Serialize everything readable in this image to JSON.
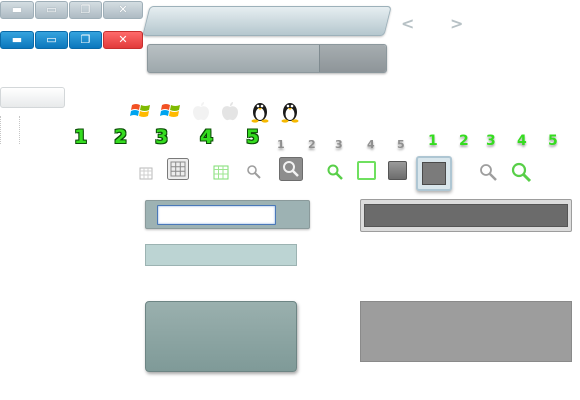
{
  "window_controls": {
    "row1": [
      {
        "name": "minimize",
        "glyph": "▬"
      },
      {
        "name": "maximize",
        "glyph": "▭"
      },
      {
        "name": "restore",
        "glyph": "❐"
      },
      {
        "name": "close",
        "glyph": "✕"
      }
    ],
    "row2": [
      {
        "name": "minimize",
        "glyph": "▬"
      },
      {
        "name": "maximize",
        "glyph": "▭"
      },
      {
        "name": "restore",
        "glyph": "❐"
      },
      {
        "name": "close",
        "glyph": "✕"
      }
    ]
  },
  "nav": {
    "prev": "<",
    "next": ">"
  },
  "os_icons": [
    "windows-icon",
    "windows-icon",
    "apple-icon",
    "apple-icon",
    "linux-icon",
    "linux-icon"
  ],
  "big_numbers": [
    "1",
    "2",
    "3",
    "4",
    "5"
  ],
  "small_numbers": [
    "1",
    "2",
    "3",
    "4",
    "5"
  ],
  "green_numbers": [
    "1",
    "2",
    "3",
    "4",
    "5"
  ],
  "tool_icons": [
    "calendar-icon",
    "grid-icon",
    "calendar-icon",
    "magnifier-icon",
    "magnifier-icon",
    "magnifier-icon",
    "square-outline-icon",
    "square-icon",
    "square-selected-icon",
    "magnifier-icon",
    "magnifier-icon"
  ],
  "colors": {
    "accent_green": "#35dc20",
    "blue_button": "#0b77bd",
    "red_button": "#e13a3a",
    "teal_panel": "#9db2b3"
  }
}
